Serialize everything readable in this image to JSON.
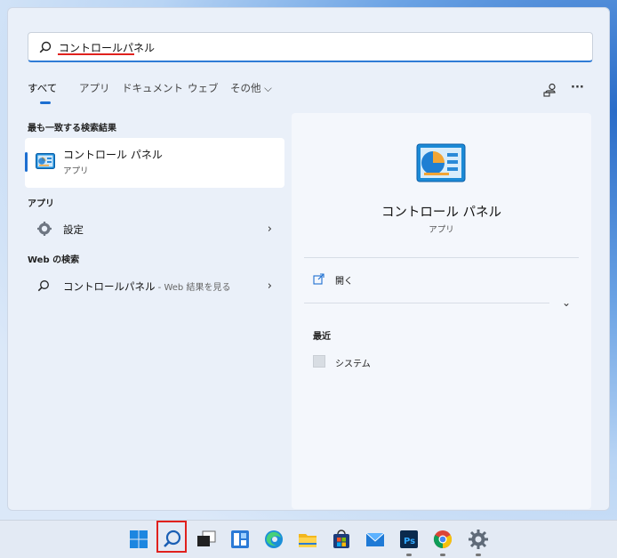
{
  "search": {
    "query": "コントロールパネル"
  },
  "tabs": [
    {
      "label": "すべて",
      "active": true
    },
    {
      "label": "アプリ"
    },
    {
      "label": "ドキュメント"
    },
    {
      "label": "ウェブ"
    },
    {
      "label": "その他 ⌵"
    }
  ],
  "toolbar": {
    "account_icon": "account-switch-icon",
    "more_label": "···"
  },
  "best_match": {
    "section_title": "最も一致する検索結果",
    "title": "コントロール パネル",
    "subtitle": "アプリ"
  },
  "apps": {
    "section_title": "アプリ",
    "items": [
      {
        "label": "設定",
        "icon": "gear-icon"
      }
    ]
  },
  "web": {
    "section_title": "Web の検索",
    "items": [
      {
        "label": "コントロールパネル",
        "suffix": " - Web 結果を見る",
        "icon": "search-icon"
      }
    ]
  },
  "detail": {
    "name": "コントロール パネル",
    "type": "アプリ",
    "open_label": "開く",
    "recent_title": "最近",
    "recent_items": [
      {
        "label": "システム"
      }
    ]
  },
  "taskbar": {
    "items": [
      "start-icon",
      "search-icon",
      "task-view-icon",
      "widgets-icon",
      "edge-icon",
      "file-explorer-icon",
      "store-icon",
      "mail-icon",
      "photoshop-icon",
      "chrome-icon",
      "settings-icon"
    ]
  },
  "colors": {
    "accent": "#1d6fd1",
    "highlight": "#e0211d"
  }
}
